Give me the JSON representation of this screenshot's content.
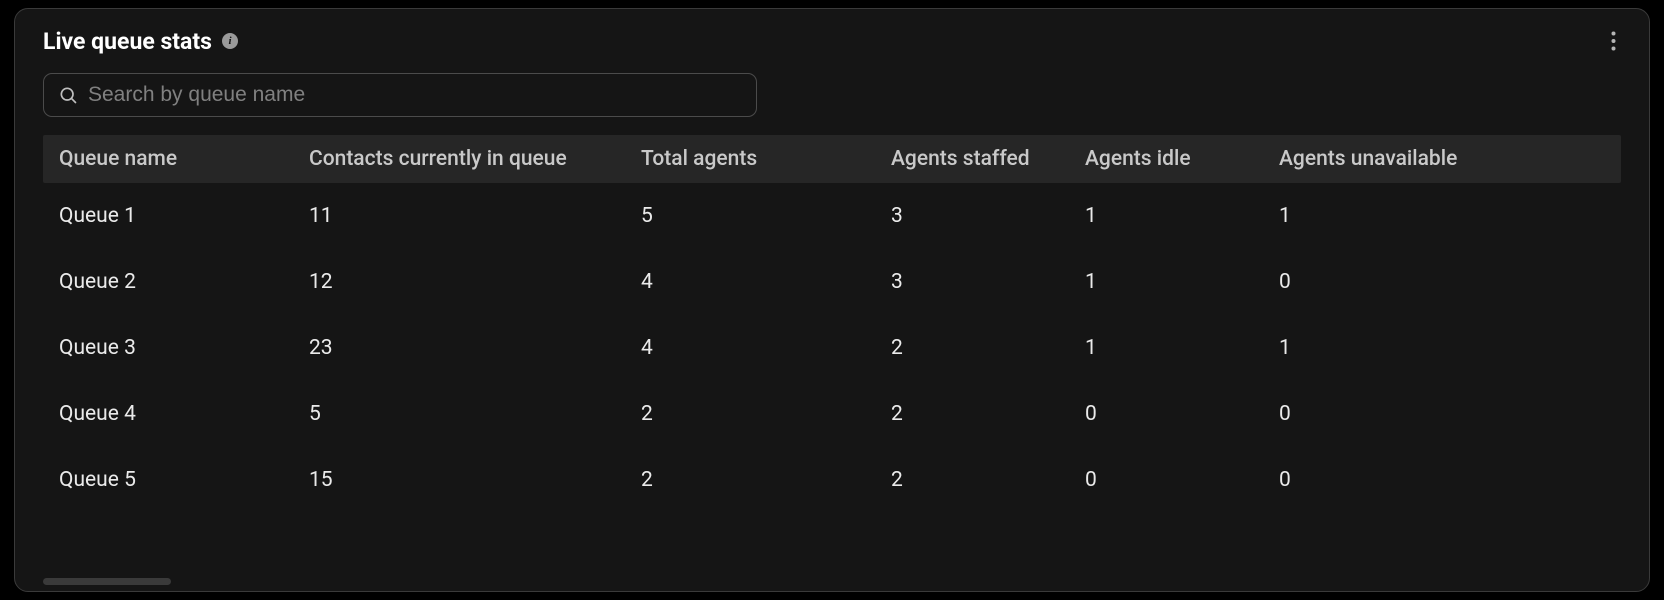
{
  "header": {
    "title": "Live queue stats"
  },
  "search": {
    "placeholder": "Search by queue name",
    "value": ""
  },
  "table": {
    "columns": {
      "name": "Queue name",
      "contacts_in_queue": "Contacts currently in queue",
      "total_agents": "Total agents",
      "agents_staffed": "Agents staffed",
      "agents_idle": "Agents idle",
      "agents_unavailable": "Agents unavailable"
    },
    "rows": [
      {
        "name": "Queue 1",
        "contacts_in_queue": "11",
        "total_agents": "5",
        "agents_staffed": "3",
        "agents_idle": "1",
        "agents_unavailable": "1"
      },
      {
        "name": "Queue 2",
        "contacts_in_queue": "12",
        "total_agents": "4",
        "agents_staffed": "3",
        "agents_idle": "1",
        "agents_unavailable": "0"
      },
      {
        "name": "Queue 3",
        "contacts_in_queue": "23",
        "total_agents": "4",
        "agents_staffed": "2",
        "agents_idle": "1",
        "agents_unavailable": "1"
      },
      {
        "name": "Queue 4",
        "contacts_in_queue": "5",
        "total_agents": "2",
        "agents_staffed": "2",
        "agents_idle": "0",
        "agents_unavailable": "0"
      },
      {
        "name": "Queue 5",
        "contacts_in_queue": "15",
        "total_agents": "2",
        "agents_staffed": "2",
        "agents_idle": "0",
        "agents_unavailable": "0"
      }
    ]
  }
}
